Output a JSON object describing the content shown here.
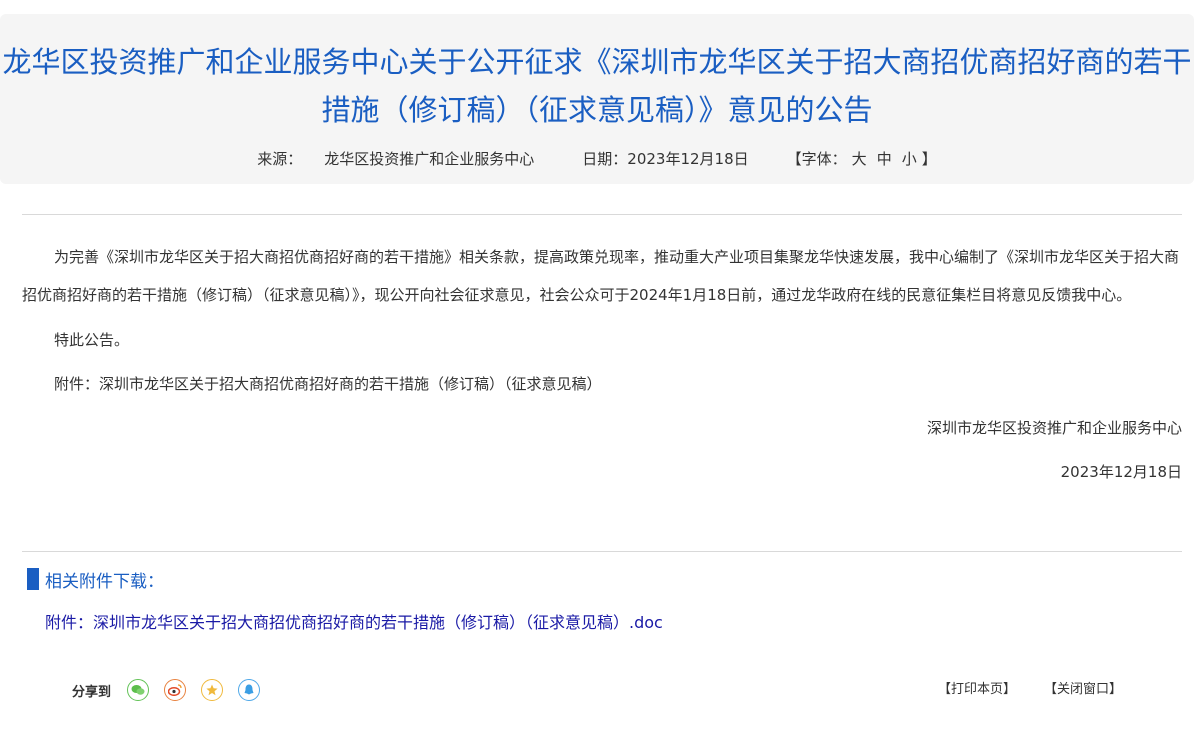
{
  "article": {
    "title": "龙华区投资推广和企业服务中心关于公开征求《深圳市龙华区关于招大商招优商招好商的若干措施（修订稿）（征求意见稿）》意见的公告",
    "source_label": "来源：",
    "source_value": "龙华区投资推广和企业服务中心",
    "date_label": "日期：",
    "date_value": "2023年12月18日",
    "font_open": "【字体：",
    "font_large": "大",
    "font_medium": "中",
    "font_small": "小",
    "font_close": "】"
  },
  "body": {
    "paragraph_1": "为完善《深圳市龙华区关于招大商招优商招好商的若干措施》相关条款，提高政策兑现率，推动重大产业项目集聚龙华快速发展，我中心编制了《深圳市龙华区关于招大商招优商招好商的若干措施（修订稿）（征求意见稿）》，现公开向社会征求意见，社会公众可于2024年1月18日前，通过龙华政府在线的民意征集栏目将意见反馈我中心。",
    "paragraph_2": "特此公告。",
    "attachment_note": "附件：深圳市龙华区关于招大商招优商招好商的若干措施（修订稿）（征求意见稿）",
    "signature": "深圳市龙华区投资推广和企业服务中心",
    "sign_date": "2023年12月18日"
  },
  "attachments": {
    "heading": "相关附件下载：",
    "items": [
      {
        "label": "附件：深圳市龙华区关于招大商招优商招好商的若干措施（修订稿）（征求意见稿）.doc"
      }
    ]
  },
  "share": {
    "label": "分享到",
    "icons": [
      "wechat-icon",
      "weibo-icon",
      "favorite-icon",
      "qq-icon"
    ]
  },
  "actions": {
    "print": "【打印本页】",
    "close": "【关闭窗口】"
  },
  "colors": {
    "title": "#1a5ec2",
    "link": "#1a1aa6",
    "header_bg": "#f5f5f5"
  }
}
